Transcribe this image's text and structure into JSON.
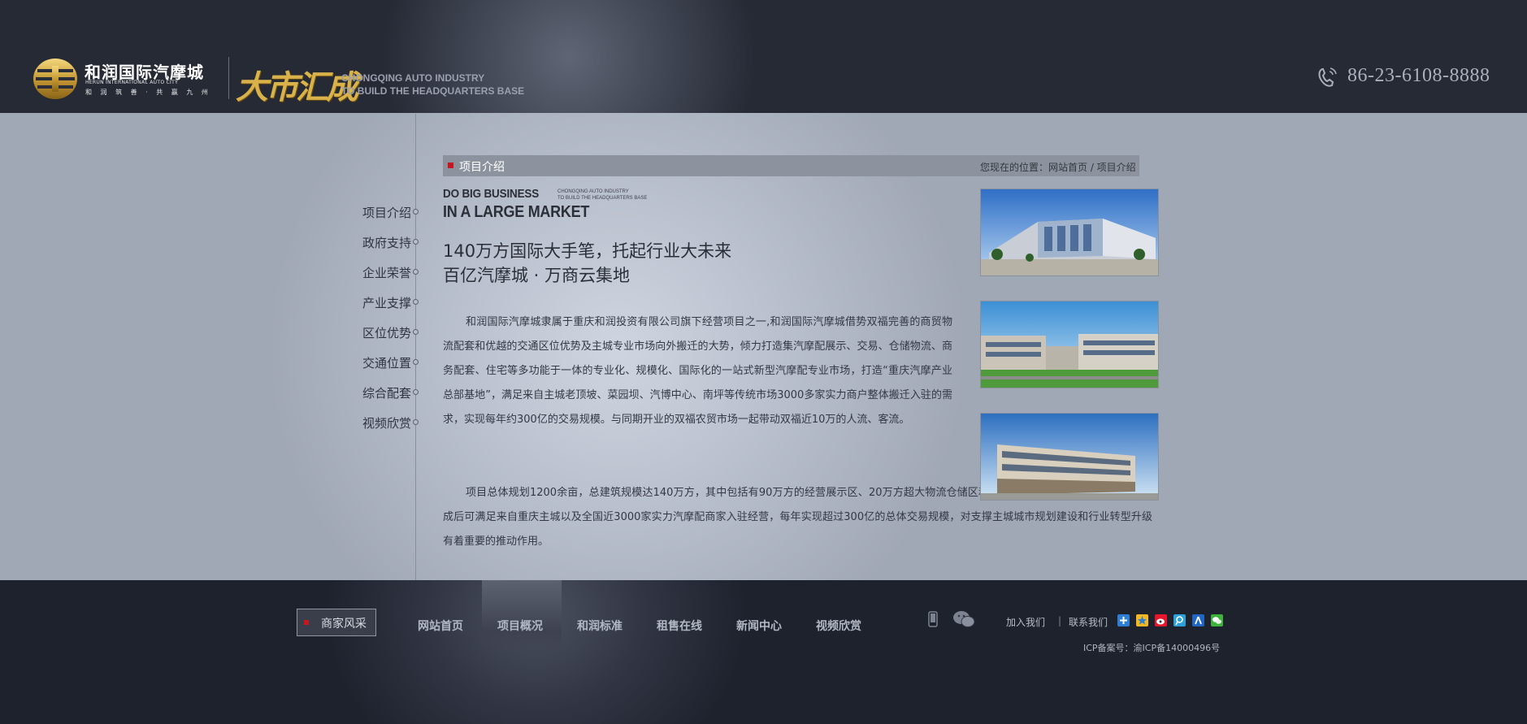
{
  "header": {
    "logo_cn": "和润国际汽摩城",
    "logo_en": "HERUN INTERNATIONAL AUTO CITY",
    "logo_slogan": "和 润 筑 善 · 共 赢 九 州",
    "brand_calligraphy": "大市汇成",
    "brand_en_line1": "CHONGQING AUTO INDUSTRY",
    "brand_en_line2": "TO BUILD THE HEADQUARTERS BASE",
    "phone_icon": "phone-icon",
    "phone": "86-23-6108-8888",
    "colors": {
      "gold": "#d9b24a",
      "dark": "#262a35"
    }
  },
  "sidebar": {
    "items": [
      {
        "label": "项目介绍"
      },
      {
        "label": "政府支持"
      },
      {
        "label": "企业荣誉"
      },
      {
        "label": "产业支撑"
      },
      {
        "label": "区位优势"
      },
      {
        "label": "交通位置"
      },
      {
        "label": "综合配套"
      },
      {
        "label": "视频欣赏"
      }
    ]
  },
  "content": {
    "section_title": "项目介绍",
    "breadcrumb": "您现在的位置：网站首页 / 项目介绍",
    "en_title_line1": "DO BIG BUSINESS",
    "en_title_line2": "IN A LARGE MARKET",
    "en_small_line1": "CHONGQING AUTO INDUSTRY",
    "en_small_line2": "TO BUILD THE HEADQUARTERS BASE",
    "headline_line1": "140万方国际大手笔，托起行业大未来",
    "headline_line2": "百亿汽摩城 · 万商云集地",
    "paragraph1": "和润国际汽摩城隶属于重庆和润投资有限公司旗下经营项目之一,和润国际汽摩城借势双福完善的商贸物流配套和优越的交通区位优势及主城专业市场向外搬迁的大势，倾力打造集汽摩配展示、交易、仓储物流、商务配套、住宅等多功能于一体的专业化、规模化、国际化的一站式新型汽摩配专业市场，打造“重庆汽摩产业总部基地”，满足来自主城老顶坡、菜园坝、汽博中心、南坪等传统市场3000多家实力商户整体搬迁入驻的需求，实现每年约300亿的交易规模。与同期开业的双福农贸市场一起带动双福近10万的人流、客流。",
    "paragraph2": "项目总体规划1200余亩，总建筑规模达140万方，其中包括有90万方的经营展示区、20万方超大物流仓储区和30万方居住和商务配套区。市场建成后可满足来自重庆主城以及全国近3000家实力汽摩配商家入驻经营，每年实现超过300亿的总体交易规模，对支撑主城城市规划建设和行业转型升级有着重要的推动作用。",
    "accent_color": "#c8161d"
  },
  "footer": {
    "merchant_button": "商家风采",
    "nav": [
      {
        "label": "网站首页"
      },
      {
        "label": "项目概况"
      },
      {
        "label": "和润标准"
      },
      {
        "label": "租售在线"
      },
      {
        "label": "新闻中心"
      },
      {
        "label": "视频欣赏"
      }
    ],
    "active_nav": "项目概况",
    "join_us": "加入我们",
    "separator": "|",
    "contact_us": "联系我们",
    "share_icons": [
      "qzone-plus-icon",
      "qzone-star-icon",
      "weibo-icon",
      "tencent-weibo-icon",
      "renren-icon",
      "wechat-share-icon"
    ],
    "icp": "ICP备案号：渝ICP备14000496号"
  }
}
